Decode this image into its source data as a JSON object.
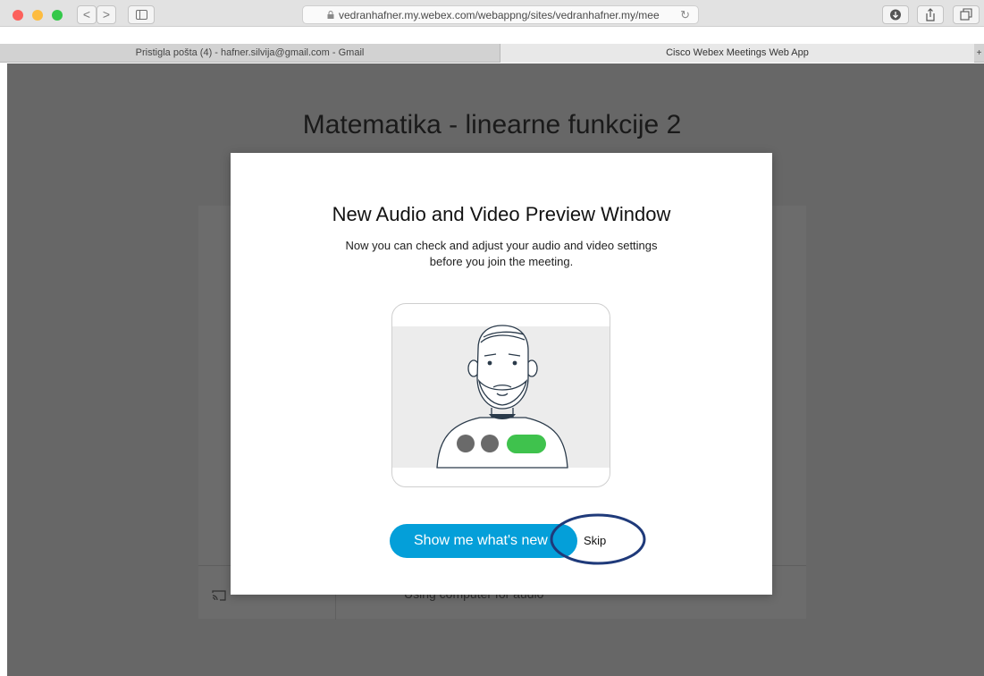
{
  "browser": {
    "url": "vedranhafner.my.webex.com/webappng/sites/vedranhafner.my/mee",
    "tabs": [
      {
        "label": "Pristigla pošta (4) - hafner.silvija@gmail.com - Gmail"
      },
      {
        "label": "Cisco Webex Meetings Web App"
      }
    ],
    "nav_back": "<",
    "nav_forward": ">",
    "reload_glyph": "↻",
    "tab_more": "+"
  },
  "meeting": {
    "title": "Matematika - linearne funkcije 2"
  },
  "modal": {
    "title": "New Audio and Video Preview Window",
    "description_line1": "Now you can check and adjust your audio and video settings",
    "description_line2": "before you join the meeting.",
    "primary_button": "Show me what's new",
    "skip_button": "Skip"
  },
  "background": {
    "audio_label": "Using computer for audio"
  },
  "colors": {
    "accent": "#049fd9",
    "annotation": "#1f3a7a",
    "toggle_on": "#3fc24d",
    "toggle_off": "#6a6a6a"
  },
  "icons": [
    "lock-icon",
    "reload-icon",
    "download-icon",
    "share-icon",
    "tabs-icon",
    "sidebar-icon",
    "cast-icon",
    "avatar-illustration"
  ]
}
